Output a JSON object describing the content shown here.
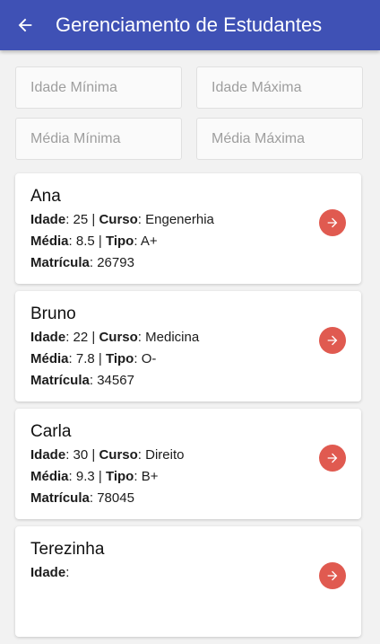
{
  "appbar": {
    "title": "Gerenciamento de Estudantes",
    "back_icon": "arrow-left-icon",
    "color": "#3f51b5"
  },
  "filters": {
    "idade_min_placeholder": "Idade Mínima",
    "idade_max_placeholder": "Idade Máxima",
    "media_min_placeholder": "Média Mínima",
    "media_max_placeholder": "Média Máxima"
  },
  "labels": {
    "idade": "Idade",
    "curso": "Curso",
    "media": "Média",
    "tipo": "Tipo",
    "matricula": "Matrícula",
    "colon": ":",
    "separator": " | "
  },
  "students": [
    {
      "name": "Ana",
      "idade": "25",
      "curso": "Engenerhia",
      "media": "8.5",
      "tipo": "A+",
      "matricula": "26793"
    },
    {
      "name": "Bruno",
      "idade": "22",
      "curso": "Medicina",
      "media": "7.8",
      "tipo": "O-",
      "matricula": "34567"
    },
    {
      "name": "Carla",
      "idade": "30",
      "curso": "Direito",
      "media": "9.3",
      "tipo": "B+",
      "matricula": "78045"
    },
    {
      "name": "Terezinha",
      "idade": "",
      "curso": "",
      "media": "",
      "tipo": "",
      "matricula": ""
    }
  ],
  "accent_button_color": "#e05a50",
  "card_action_icon": "arrow-right-icon"
}
